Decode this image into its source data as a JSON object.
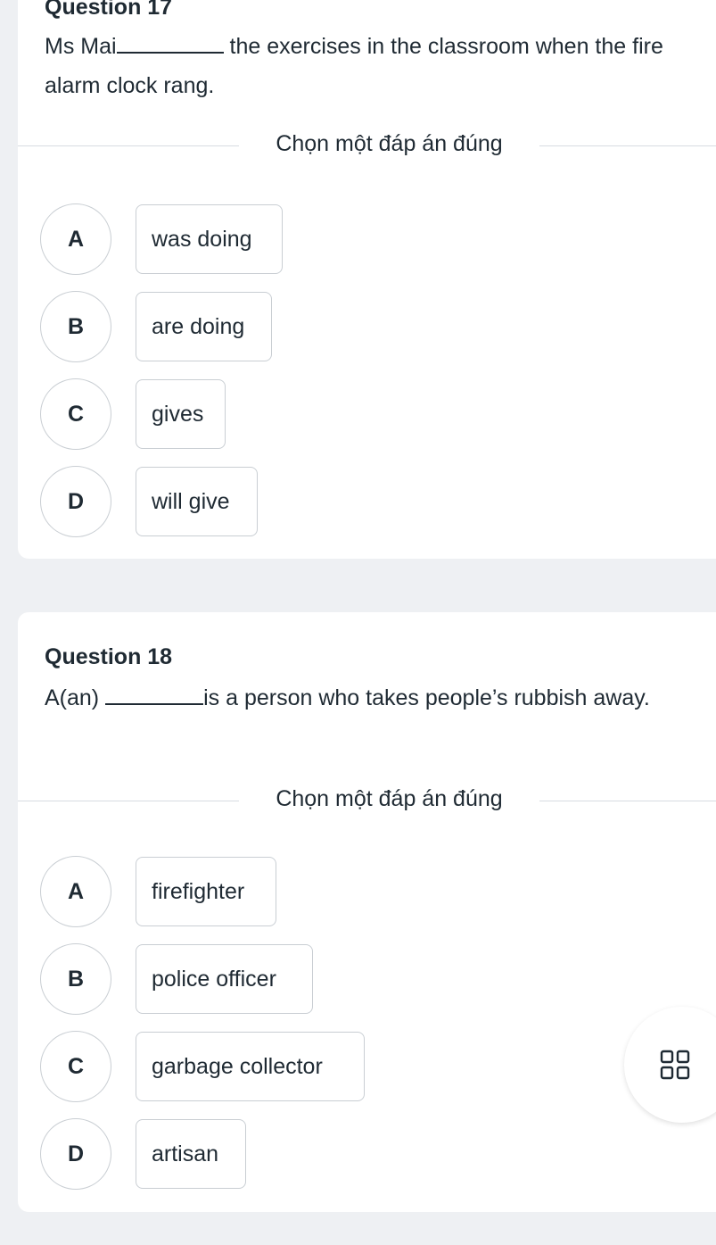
{
  "q17": {
    "title": "Question 17",
    "text_before": "Ms Mai",
    "text_after": " the exercises in the classroom when the fire alarm clock rang.",
    "prompt": "Chọn một đáp án đúng",
    "options": [
      {
        "letter": "A",
        "text": "was doing"
      },
      {
        "letter": "B",
        "text": "are doing"
      },
      {
        "letter": "C",
        "text": "gives"
      },
      {
        "letter": "D",
        "text": "will give"
      }
    ]
  },
  "q18": {
    "title": "Question 18",
    "text_before": "A(an) ",
    "text_after": "is a person who takes people’s rubbish away.",
    "prompt": "Chọn một đáp án đúng",
    "options": [
      {
        "letter": "A",
        "text": "firefighter"
      },
      {
        "letter": "B",
        "text": "police officer"
      },
      {
        "letter": "C",
        "text": "garbage collector"
      },
      {
        "letter": "D",
        "text": "artisan"
      }
    ]
  },
  "fab": {
    "icon": "grid-icon"
  }
}
